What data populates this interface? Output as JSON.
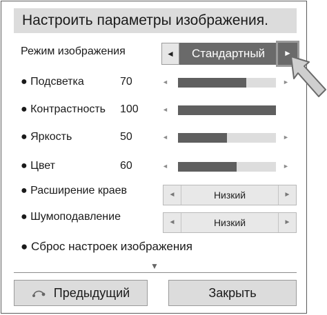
{
  "title": "Настроить параметры изображения.",
  "mode": {
    "label": "Режим изображения",
    "left_arrow": "◄",
    "value": "Стандартный",
    "right_arrow": "►"
  },
  "sliders": [
    {
      "label": "● Подсветка",
      "value": "70",
      "fraction": 0.7
    },
    {
      "label": "● Контрастность",
      "value": "100",
      "fraction": 1.0
    },
    {
      "label": "● Яркость",
      "value": "50",
      "fraction": 0.5
    },
    {
      "label": "● Цвет",
      "value": "60",
      "fraction": 0.6
    }
  ],
  "slider_arrows": {
    "left": "◄",
    "right": "►"
  },
  "options": [
    {
      "label": "● Расширение краев",
      "value": "Низкий",
      "left_arrow": "◄",
      "right_arrow": "►"
    },
    {
      "label": "● Шумоподавление",
      "value": "Низкий",
      "left_arrow": "◄",
      "right_arrow": "►"
    }
  ],
  "reset_label": "● Сброс настроек изображения",
  "more_indicator": "▼",
  "footer": {
    "back_label": "Предыдущий",
    "close_label": "Закрыть"
  },
  "colors": {
    "selected_bg": "#6a6a6a",
    "slider_fill": "#5f5f5f",
    "slider_track": "#dddddd",
    "button_bg": "#dcdcdc"
  },
  "icons": {
    "back": "back-icon",
    "pointer": "pointer-cursor-icon"
  }
}
